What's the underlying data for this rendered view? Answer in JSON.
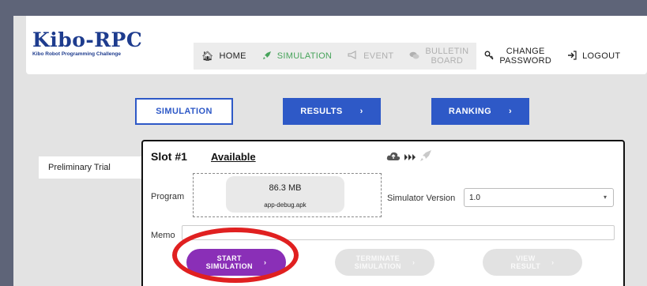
{
  "brand": {
    "title": "Kibo-RPC",
    "subtitle": "Kibo Robot Programming Challenge"
  },
  "nav": {
    "home": "HOME",
    "simulation": "SIMULATION",
    "event": "EVENT",
    "bulletin_line1": "BULLETIN",
    "bulletin_line2": "BOARD",
    "change_password_line1": "CHANGE",
    "change_password_line2": "PASSWORD",
    "logout": "LOGOUT"
  },
  "tabs": {
    "simulation": "SIMULATION",
    "results": "RESULTS",
    "ranking": "RANKING",
    "arrow": "›"
  },
  "sidebar": {
    "items": [
      "Preliminary Trial"
    ]
  },
  "slot": {
    "title": "Slot #1",
    "status": "Available",
    "program_label": "Program",
    "file_size": "86.3 MB",
    "file_name": "app-debug.apk",
    "sim_version_label": "Simulator Version",
    "sim_version_value": "1.0",
    "memo_label": "Memo",
    "memo_value": "",
    "start_line1": "START",
    "start_line2": "SIMULATION",
    "terminate_line1": "TERMINATE",
    "terminate_line2": "SIMULATION",
    "view_line1": "VIEW",
    "view_line2": "RESULT",
    "arrow": "›"
  },
  "colors": {
    "brand": "#1e3c8e",
    "accent_blue": "#2e59c7",
    "start_purple": "#8a2fb7",
    "active_green": "#46a35a",
    "highlight_red": "#e02020"
  }
}
